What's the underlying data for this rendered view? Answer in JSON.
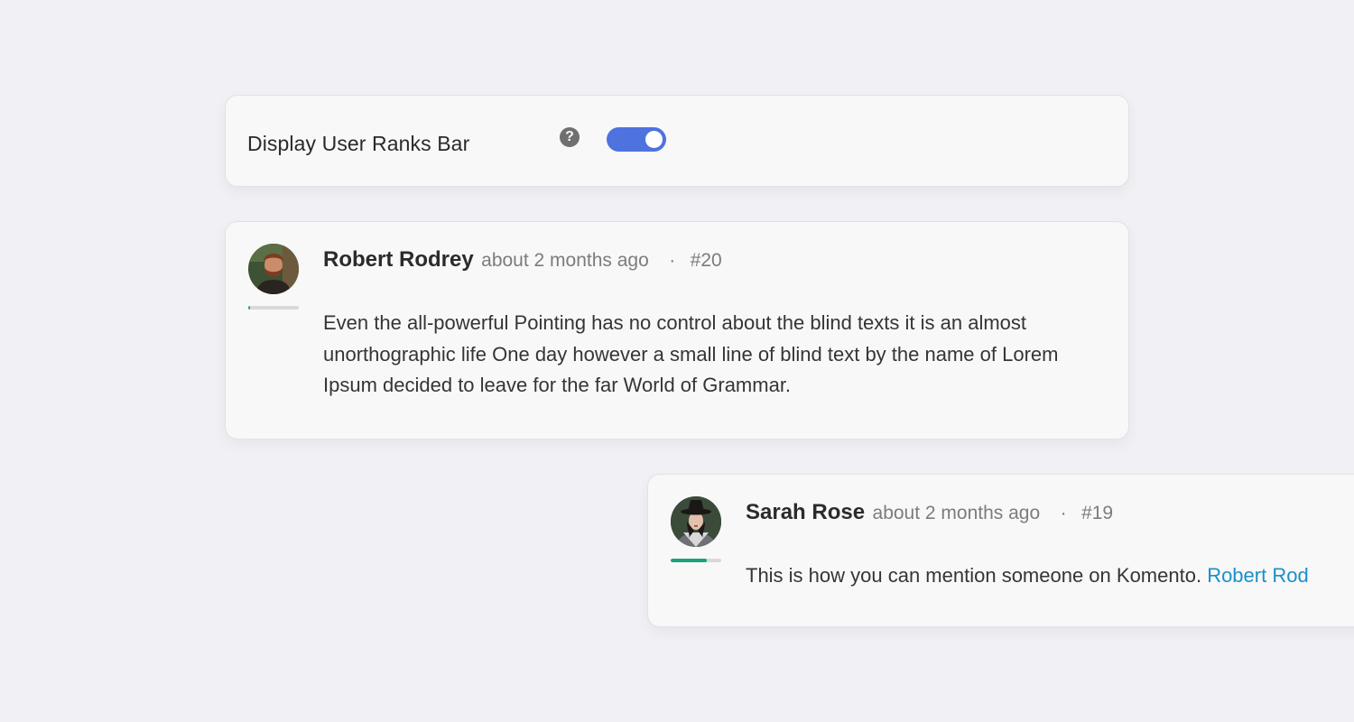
{
  "settings": {
    "label": "Display User Ranks Bar",
    "help_icon": "question-circle-icon",
    "toggle_on": true,
    "toggle_color": "#4e73df"
  },
  "comments": [
    {
      "author": "Robert Rodrey",
      "time": "about 2 months ago",
      "separator": "·",
      "permalink": "#20",
      "body": "Even the all-powerful Pointing has no control about the blind texts it is an almost unorthographic life One day however a small line of blind text by the name of Lorem Ipsum decided to leave for the far World of Grammar.",
      "rank_progress": 0.04,
      "rank_color": "#16a47a"
    },
    {
      "author": "Sarah Rose",
      "time": "about 2 months ago",
      "separator": "·",
      "permalink": "#19",
      "body": "This is how you can mention someone on Komento.",
      "mention": "Robert Rod",
      "rank_progress": 0.71,
      "rank_color": "#16a47a"
    }
  ]
}
